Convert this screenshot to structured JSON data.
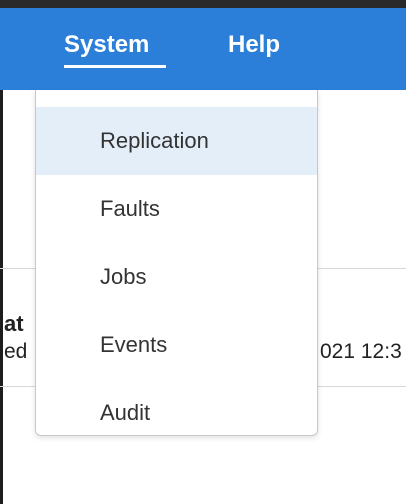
{
  "top_strip": {
    "partial_text": ""
  },
  "nav": {
    "items": [
      {
        "label": "System",
        "active": true
      },
      {
        "label": "Help",
        "active": false
      }
    ]
  },
  "dropdown": {
    "items": [
      {
        "label": "Replication",
        "highlighted": true
      },
      {
        "label": "Faults",
        "highlighted": false
      },
      {
        "label": "Jobs",
        "highlighted": false
      },
      {
        "label": "Events",
        "highlighted": false
      },
      {
        "label": "Audit",
        "highlighted": false
      }
    ]
  },
  "background": {
    "heading_fragment": "at",
    "status_fragment": "ed",
    "date_fragment": "021 12:3"
  },
  "colors": {
    "nav_bg": "#2b7fd9",
    "highlight_bg": "#e4eef9",
    "text": "#333333"
  }
}
